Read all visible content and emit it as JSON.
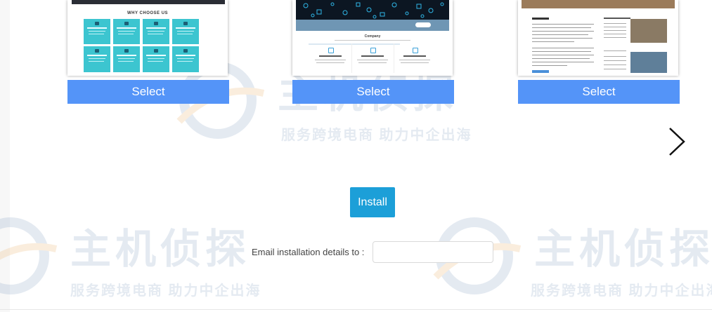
{
  "themes": [
    {
      "select_label": "Select",
      "section_heading": "WHY CHOOSE US"
    },
    {
      "select_label": "Select",
      "section_heading": "Company"
    },
    {
      "select_label": "Select"
    }
  ],
  "carousel": {
    "next_icon": "chevron-right-icon"
  },
  "install": {
    "button_label": "Install"
  },
  "email": {
    "label": "Email installation details to :",
    "value": ""
  },
  "watermark": {
    "logo_text": "主机侦探",
    "tagline": "服务跨境电商 助力中企出海"
  },
  "colors": {
    "select_button": "#5494f8",
    "install_button": "#1c9fd8",
    "tile_cyan": "#3cc5d0",
    "watermark": "#6d8fb8"
  }
}
